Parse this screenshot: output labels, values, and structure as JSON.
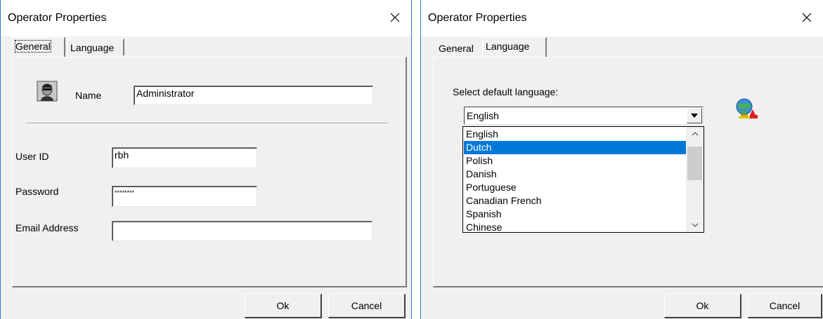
{
  "dialogs": {
    "general": {
      "title": "Operator Properties",
      "tabs": [
        "General",
        "Language"
      ],
      "active_tab": "General",
      "name_label": "Name",
      "name_value": "Administrator",
      "user_id_label": "User ID",
      "user_id_value": "rbh",
      "password_label": "Password",
      "password_value": "********",
      "email_label": "Email Address",
      "email_value": "",
      "ok_label": "Ok",
      "cancel_label": "Cancel"
    },
    "language": {
      "title": "Operator Properties",
      "tabs": [
        "General",
        "Language"
      ],
      "active_tab": "Language",
      "select_label": "Select default language:",
      "combo_value": "English",
      "options": [
        "English",
        "Dutch",
        "Polish",
        "Danish",
        "Portuguese",
        "Canadian French",
        "Spanish",
        "Chinese"
      ],
      "highlighted_option": "Dutch",
      "ok_label": "Ok",
      "cancel_label": "Cancel"
    }
  },
  "icons": {
    "close": "close-icon",
    "user": "user-avatar-icon",
    "globe": "globe-language-icon",
    "combo_arrow": "dropdown-arrow-icon",
    "scroll_up": "scroll-up-icon",
    "scroll_down": "scroll-down-icon"
  },
  "colors": {
    "window_border": "#2b79d7",
    "face": "#f0f0f0",
    "selection": "#0078d7"
  }
}
